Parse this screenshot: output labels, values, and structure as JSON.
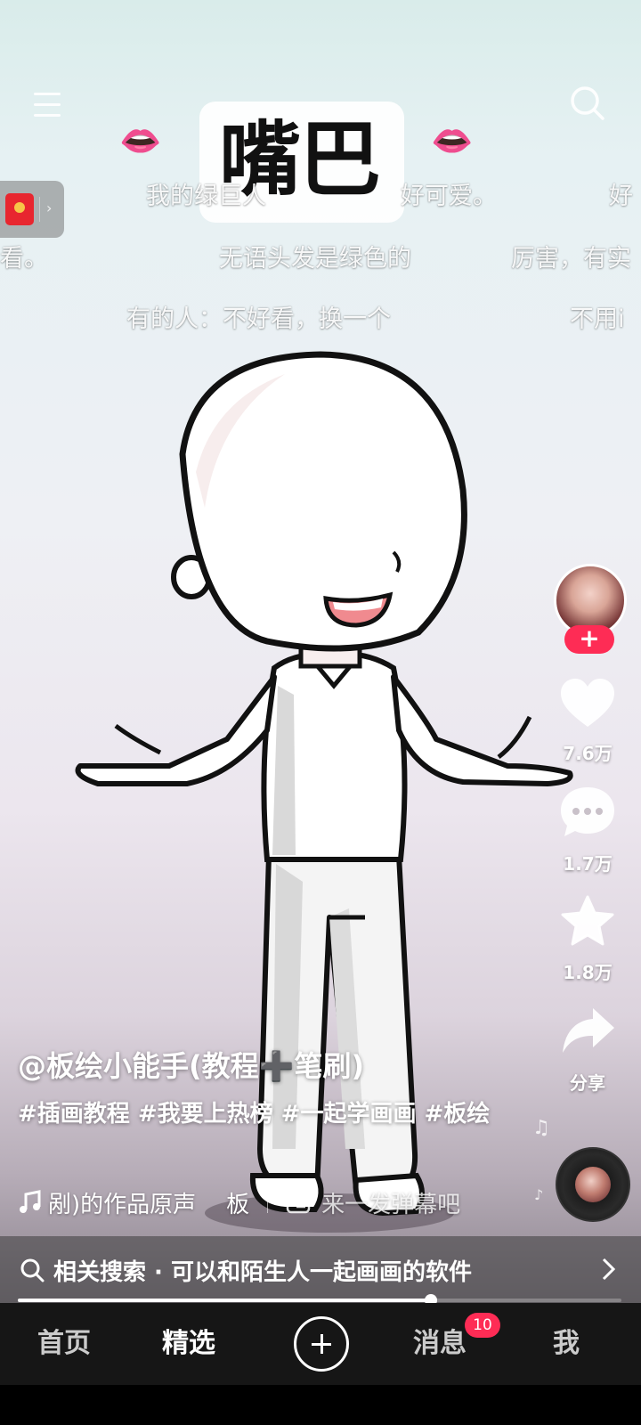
{
  "title_sticker": {
    "text": "嘴巴",
    "left_emoji": "👄",
    "right_emoji": "👄"
  },
  "danmaku": [
    "我的绿巨人",
    "好可爱。",
    "好",
    "看。",
    "无语头发是绿色的",
    "厉害，有实",
    "有的人：不好看，换一个",
    "不用i"
  ],
  "top_bar": {
    "menu_icon": "menu-icon",
    "search_icon": "search-icon"
  },
  "red_packet": {
    "icon": "red-envelope-icon",
    "arrow": "›"
  },
  "right_rail": {
    "avatar": "creator-avatar",
    "follow_label": "+",
    "like_count": "7.6万",
    "comment_count": "1.7万",
    "favorite_count": "1.8万",
    "share_label": "分享"
  },
  "video_info": {
    "author": "@板绘小能手(教程➕笔刷)",
    "description": "#插画教程 #我要上热榜 #一起学画画 #板绘",
    "music_text": "剐)的作品原声",
    "music_extra": "板",
    "danmaku_prompt": "来一发弹幕吧"
  },
  "related_search": {
    "text": "相关搜索 · 可以和陌生人一起画画的软件"
  },
  "progress": {
    "fraction": 0.685
  },
  "bottom_nav": {
    "home": "首页",
    "featured": "精选",
    "messages": "消息",
    "messages_badge": "10",
    "me": "我"
  },
  "colors": {
    "accent": "#fe2c55",
    "nav_bg": "#161616"
  }
}
